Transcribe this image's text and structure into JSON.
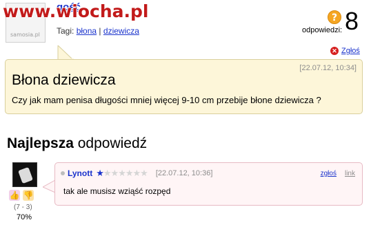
{
  "watermark": {
    "text": "www.wiocha.pl"
  },
  "asker": {
    "name": "gość",
    "avatar_label": "samosia.pl"
  },
  "tags": {
    "label": "Tagi:",
    "items": [
      "błona",
      "dziewicza"
    ],
    "separator": "|"
  },
  "answers_summary": {
    "label": "odpowiedzi:",
    "count": "8",
    "icon": "question-icon"
  },
  "report": {
    "label": "Zgłoś",
    "icon": "close-icon"
  },
  "question": {
    "date": "[22.07.12, 10:34]",
    "title": "Błona dziewicza",
    "body": "Czy jak mam penisa długości mniej więcej 9-10 cm przebije błone dziewicza ?"
  },
  "best_answer": {
    "heading_bold": "Najlepsza",
    "heading_rest": " odpowiedź",
    "author": "Lynott",
    "rating_filled": 1,
    "rating_total": 7,
    "date": "[22.07.12, 10:36]",
    "report_label": "zgłoś",
    "link_label": "link",
    "body": "tak ale musisz wziąść rozpęd",
    "votes": {
      "counts": "(7 - 3)",
      "percent": "70%"
    }
  },
  "colors": {
    "link": "#1a33cc",
    "question_bg": "#fdf6d9",
    "answer_bg": "#fff5f6",
    "watermark": "#c21a1a",
    "alert": "#f5a623"
  }
}
